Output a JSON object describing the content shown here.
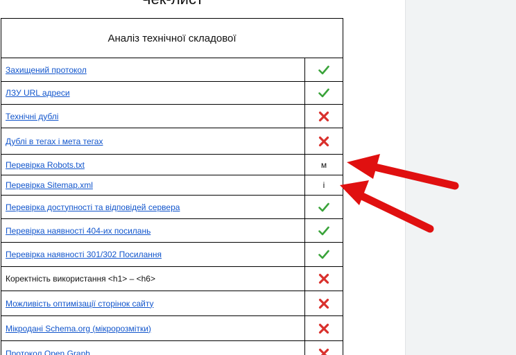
{
  "document": {
    "title": "Чек-лист",
    "table_header": "Аналіз технічної складової",
    "rows": [
      {
        "label": "Захищений протокол",
        "link": true,
        "mark": "check",
        "text": ""
      },
      {
        "label": "ЛЗУ URL адреси",
        "link": true,
        "mark": "check",
        "text": ""
      },
      {
        "label": "Технічні дублі",
        "link": true,
        "mark": "cross",
        "text": ""
      },
      {
        "label": "Дублі в тегах і мета тегах",
        "link": true,
        "mark": "cross",
        "text": ""
      },
      {
        "label": "Перевірка Robots.txt",
        "link": true,
        "mark": "text",
        "text": "м"
      },
      {
        "label": "Перевірка Sitemap.xml",
        "link": true,
        "mark": "text",
        "text": "і"
      },
      {
        "label": "Перевірка доступності та відповідей сервера",
        "link": true,
        "mark": "check",
        "text": ""
      },
      {
        "label": "Перевірка наявності 404-их посилань",
        "link": true,
        "mark": "check",
        "text": ""
      },
      {
        "label": "Перевірка наявності 301/302 Посилання",
        "link": true,
        "mark": "check",
        "text": ""
      },
      {
        "label": "Коректність використання <h1> – <h6>",
        "link": false,
        "mark": "cross",
        "text": ""
      },
      {
        "label": "Можливість оптимізації сторінок сайту",
        "link": true,
        "mark": "cross",
        "text": ""
      },
      {
        "label": "Мікродані Schema.org (мікророзмітки)",
        "link": true,
        "mark": "cross",
        "text": ""
      },
      {
        "label": "Протокол Open Graph",
        "link": true,
        "mark": "cross",
        "text": ""
      }
    ]
  },
  "icons": {
    "check": "check-icon",
    "cross": "cross-icon",
    "arrow": "red-arrow-annotation"
  },
  "colors": {
    "link": "#1155cc",
    "check": "#3aa33a",
    "cross": "#d9302c",
    "arrow": "#e01010",
    "panel": "#f1f3f4"
  }
}
